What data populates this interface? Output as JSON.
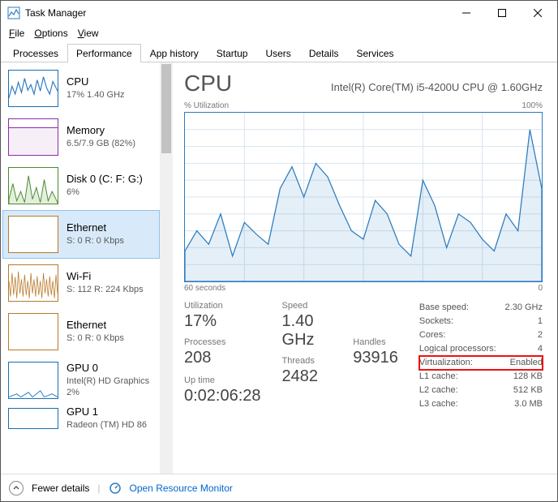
{
  "window": {
    "title": "Task Manager"
  },
  "menu": {
    "file": "File",
    "options": "Options",
    "view": "View"
  },
  "tabs": [
    "Processes",
    "Performance",
    "App history",
    "Startup",
    "Users",
    "Details",
    "Services"
  ],
  "active_tab": "Performance",
  "sidebar": {
    "items": [
      {
        "name": "CPU",
        "sub": "17% 1.40 GHz",
        "kind": "cpu"
      },
      {
        "name": "Memory",
        "sub": "6.5/7.9 GB (82%)",
        "kind": "mem"
      },
      {
        "name": "Disk 0 (C: F: G:)",
        "sub": "6%",
        "kind": "disk"
      },
      {
        "name": "Ethernet",
        "sub": "S: 0 R: 0 Kbps",
        "kind": "eth",
        "selected": true
      },
      {
        "name": "Wi-Fi",
        "sub": "S: 112 R: 224 Kbps",
        "kind": "wifi"
      },
      {
        "name": "Ethernet",
        "sub": "S: 0 R: 0 Kbps",
        "kind": "eth2"
      },
      {
        "name": "GPU 0",
        "sub": "Intel(R) HD Graphics",
        "sub2": "2%",
        "kind": "gpu"
      },
      {
        "name": "GPU 1",
        "sub": "Radeon (TM) HD 86",
        "kind": "gpu"
      }
    ]
  },
  "main": {
    "title": "CPU",
    "cpu_name": "Intel(R) Core(TM) i5-4200U CPU @ 1.60GHz",
    "chart": {
      "top_left": "% Utilization",
      "top_right": "100%",
      "bottom_left": "60 seconds",
      "bottom_right": "0"
    },
    "stats": {
      "utilization_label": "Utilization",
      "utilization": "17%",
      "speed_label": "Speed",
      "speed": "1.40 GHz",
      "processes_label": "Processes",
      "processes": "208",
      "threads_label": "Threads",
      "threads": "2482",
      "handles_label": "Handles",
      "handles": "93916",
      "uptime_label": "Up time",
      "uptime": "0:02:06:28"
    },
    "specs": {
      "base_speed_l": "Base speed:",
      "base_speed": "2.30 GHz",
      "sockets_l": "Sockets:",
      "sockets": "1",
      "cores_l": "Cores:",
      "cores": "2",
      "lprocs_l": "Logical processors:",
      "lprocs": "4",
      "virt_l": "Virtualization:",
      "virt": "Enabled",
      "l1_l": "L1 cache:",
      "l1": "128 KB",
      "l2_l": "L2 cache:",
      "l2": "512 KB",
      "l3_l": "L3 cache:",
      "l3": "3.0 MB"
    }
  },
  "footer": {
    "fewer": "Fewer details",
    "monitor": "Open Resource Monitor"
  },
  "chart_data": {
    "type": "line",
    "title": "% Utilization",
    "xlabel": "seconds",
    "ylabel": "% Utilization",
    "xlim": [
      0,
      60
    ],
    "ylim": [
      0,
      100
    ],
    "x": [
      0,
      2,
      4,
      6,
      8,
      10,
      12,
      14,
      16,
      18,
      20,
      22,
      24,
      26,
      28,
      30,
      32,
      34,
      36,
      38,
      40,
      42,
      44,
      46,
      48,
      50,
      52,
      54,
      56,
      58,
      60
    ],
    "values": [
      18,
      30,
      22,
      40,
      15,
      35,
      28,
      22,
      55,
      68,
      50,
      70,
      62,
      45,
      30,
      25,
      48,
      40,
      22,
      15,
      60,
      45,
      20,
      40,
      35,
      25,
      18,
      40,
      30,
      90,
      55
    ]
  },
  "colors": {
    "cpu": "#2b7bbf",
    "mem": "#8a2da5",
    "disk": "#4a8a2a",
    "net": "#b87a2a",
    "highlight": "#e11"
  }
}
